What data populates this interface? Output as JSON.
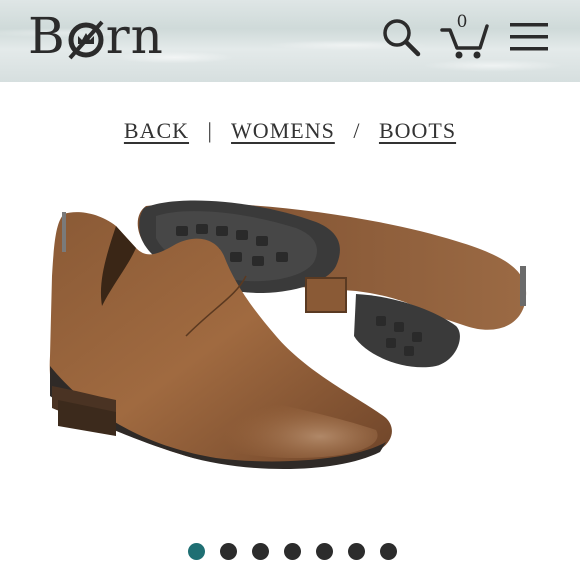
{
  "header": {
    "brand": "Børn",
    "cart_count": "0",
    "icons": [
      "search-icon",
      "cart-icon",
      "menu-icon"
    ]
  },
  "breadcrumb": {
    "items": [
      "BACK",
      "WOMENS",
      "BOOTS"
    ],
    "separators": [
      "|",
      "/"
    ]
  },
  "carousel": {
    "slide_count": 7,
    "active_index": 0,
    "active_color": "#1f6f73",
    "inactive_color": "#2c2c2c"
  },
  "product_image": {
    "subject": "brown distressed suede ankle bootie pair, side and sole view"
  }
}
